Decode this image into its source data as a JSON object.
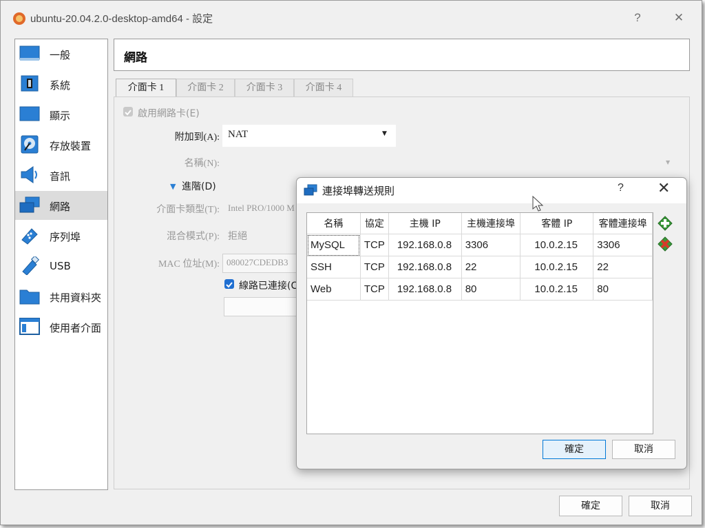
{
  "window": {
    "title": "ubuntu-20.04.2.0-desktop-amd64 - 設定",
    "help_label": "?",
    "close_label": "✕"
  },
  "sidebar": {
    "items": [
      {
        "label": "一般",
        "icon": "general-icon"
      },
      {
        "label": "系統",
        "icon": "system-icon"
      },
      {
        "label": "顯示",
        "icon": "display-icon"
      },
      {
        "label": "存放裝置",
        "icon": "storage-icon"
      },
      {
        "label": "音訊",
        "icon": "audio-icon"
      },
      {
        "label": "網路",
        "icon": "network-icon",
        "selected": true
      },
      {
        "label": "序列埠",
        "icon": "serial-port-icon"
      },
      {
        "label": "USB",
        "icon": "usb-icon"
      },
      {
        "label": "共用資料夾",
        "icon": "shared-folder-icon"
      },
      {
        "label": "使用者介面",
        "icon": "user-interface-icon"
      }
    ]
  },
  "header": {
    "title": "網路"
  },
  "tabs": [
    {
      "label": "介面卡 1",
      "active": true
    },
    {
      "label": "介面卡 2"
    },
    {
      "label": "介面卡 3"
    },
    {
      "label": "介面卡 4"
    }
  ],
  "adapter": {
    "enable_label": "啟用網路卡(E)",
    "attached_label": "附加到(A):",
    "attached_value": "NAT",
    "name_label": "名稱(N):",
    "advanced_label": "進階(D)",
    "type_label": "介面卡類型(T):",
    "type_value": "Intel PRO/1000 M",
    "promisc_label": "混合模式(P):",
    "promisc_value": "拒絕",
    "mac_label": "MAC 位址(M):",
    "mac_value": "080027CDEDB3",
    "cable_label": "線路已連接(C"
  },
  "footer": {
    "ok_label": "確定",
    "cancel_label": "取消"
  },
  "dialog": {
    "title": "連接埠轉送規則",
    "help_label": "?",
    "close_label": "✕",
    "columns": [
      "名稱",
      "協定",
      "主機 IP",
      "主機連接埠",
      "客體 IP",
      "客體連接埠"
    ],
    "rows": [
      [
        "MySQL",
        "TCP",
        "192.168.0.8",
        "3306",
        "10.0.2.15",
        "3306"
      ],
      [
        "SSH",
        "TCP",
        "192.168.0.8",
        "22",
        "10.0.2.15",
        "22"
      ],
      [
        "Web",
        "TCP",
        "192.168.0.8",
        "80",
        "10.0.2.15",
        "80"
      ]
    ],
    "ok_label": "確定",
    "cancel_label": "取消",
    "add_rule_icon": "add-rule-icon",
    "remove_rule_icon": "remove-rule-icon"
  },
  "colors": {
    "accent": "#1e5fb4",
    "selected_bg": "#dcdcdc",
    "checkbox_blue": "#1f6fd1"
  }
}
